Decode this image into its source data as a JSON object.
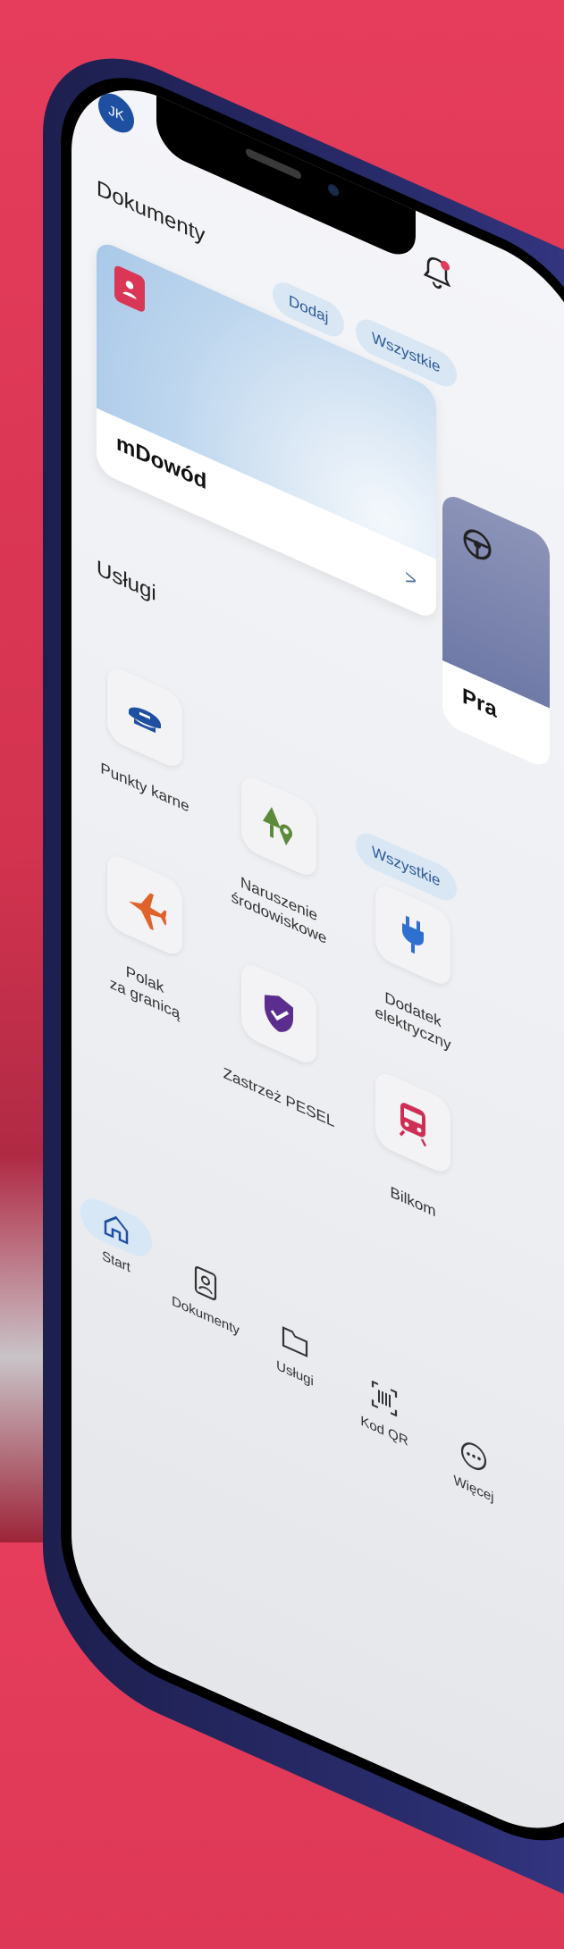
{
  "header": {
    "avatar_initials": "JK"
  },
  "documents": {
    "title": "Dokumenty",
    "add_label": "Dodaj",
    "all_label": "Wszystkie",
    "card1_title": "mDowód",
    "card2_title": "Pra"
  },
  "services": {
    "title": "Usługi",
    "all_label": "Wszystkie",
    "items": [
      {
        "label": "Punkty karne",
        "icon": "cap-icon",
        "color": "#1f4fa0"
      },
      {
        "label": "Naruszenie\nśrodowiskowe",
        "icon": "tree-pin-icon",
        "color": "#5c8a3a"
      },
      {
        "label": "Dodatek\nelektryczny",
        "icon": "plug-icon",
        "color": "#2f6fd0"
      },
      {
        "label": "Polak\nza granicą",
        "icon": "plane-icon",
        "color": "#e2622b"
      },
      {
        "label": "Zastrzeż PESEL",
        "icon": "shield-check-icon",
        "color": "#5b2d8e"
      },
      {
        "label": "Bilkom",
        "icon": "train-icon",
        "color": "#d02f55"
      }
    ]
  },
  "tabbar": {
    "items": [
      {
        "label": "Start",
        "icon": "home-icon"
      },
      {
        "label": "Dokumenty",
        "icon": "id-card-icon"
      },
      {
        "label": "Usługi",
        "icon": "folder-icon"
      },
      {
        "label": "Kod QR",
        "icon": "qr-icon"
      },
      {
        "label": "Więcej",
        "icon": "more-icon"
      }
    ]
  }
}
